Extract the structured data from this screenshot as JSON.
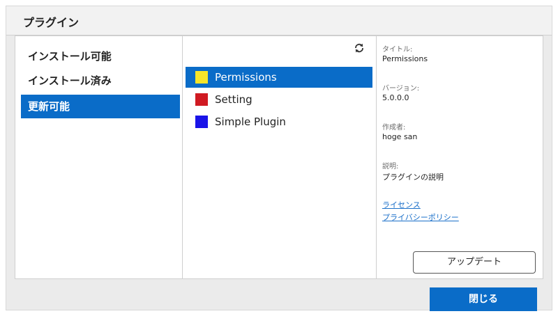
{
  "dialog": {
    "title": "プラグイン",
    "close_label": "閉じる"
  },
  "categories": [
    {
      "label": "インストール可能",
      "selected": false
    },
    {
      "label": "インストール済み",
      "selected": false
    },
    {
      "label": "更新可能",
      "selected": true
    }
  ],
  "refresh_icon": "refresh-icon",
  "plugins": [
    {
      "name": "Permissions",
      "color": "#f5e52a",
      "selected": true
    },
    {
      "name": "Setting",
      "color": "#d01a22",
      "selected": false
    },
    {
      "name": "Simple Plugin",
      "color": "#1a14e8",
      "selected": false
    }
  ],
  "details": {
    "title_label": "タイトル:",
    "title_value": "Permissions",
    "version_label": "バージョン:",
    "version_value": "5.0.0.0",
    "author_label": "作成者:",
    "author_value": "hoge san",
    "description_label": "説明:",
    "description_value": "プラグインの説明",
    "license_link": "ライセンス",
    "privacy_link": "プライバシーポリシー",
    "update_label": "アップデート"
  },
  "colors": {
    "accent": "#0a6cc8",
    "link": "#1a6fc9"
  }
}
